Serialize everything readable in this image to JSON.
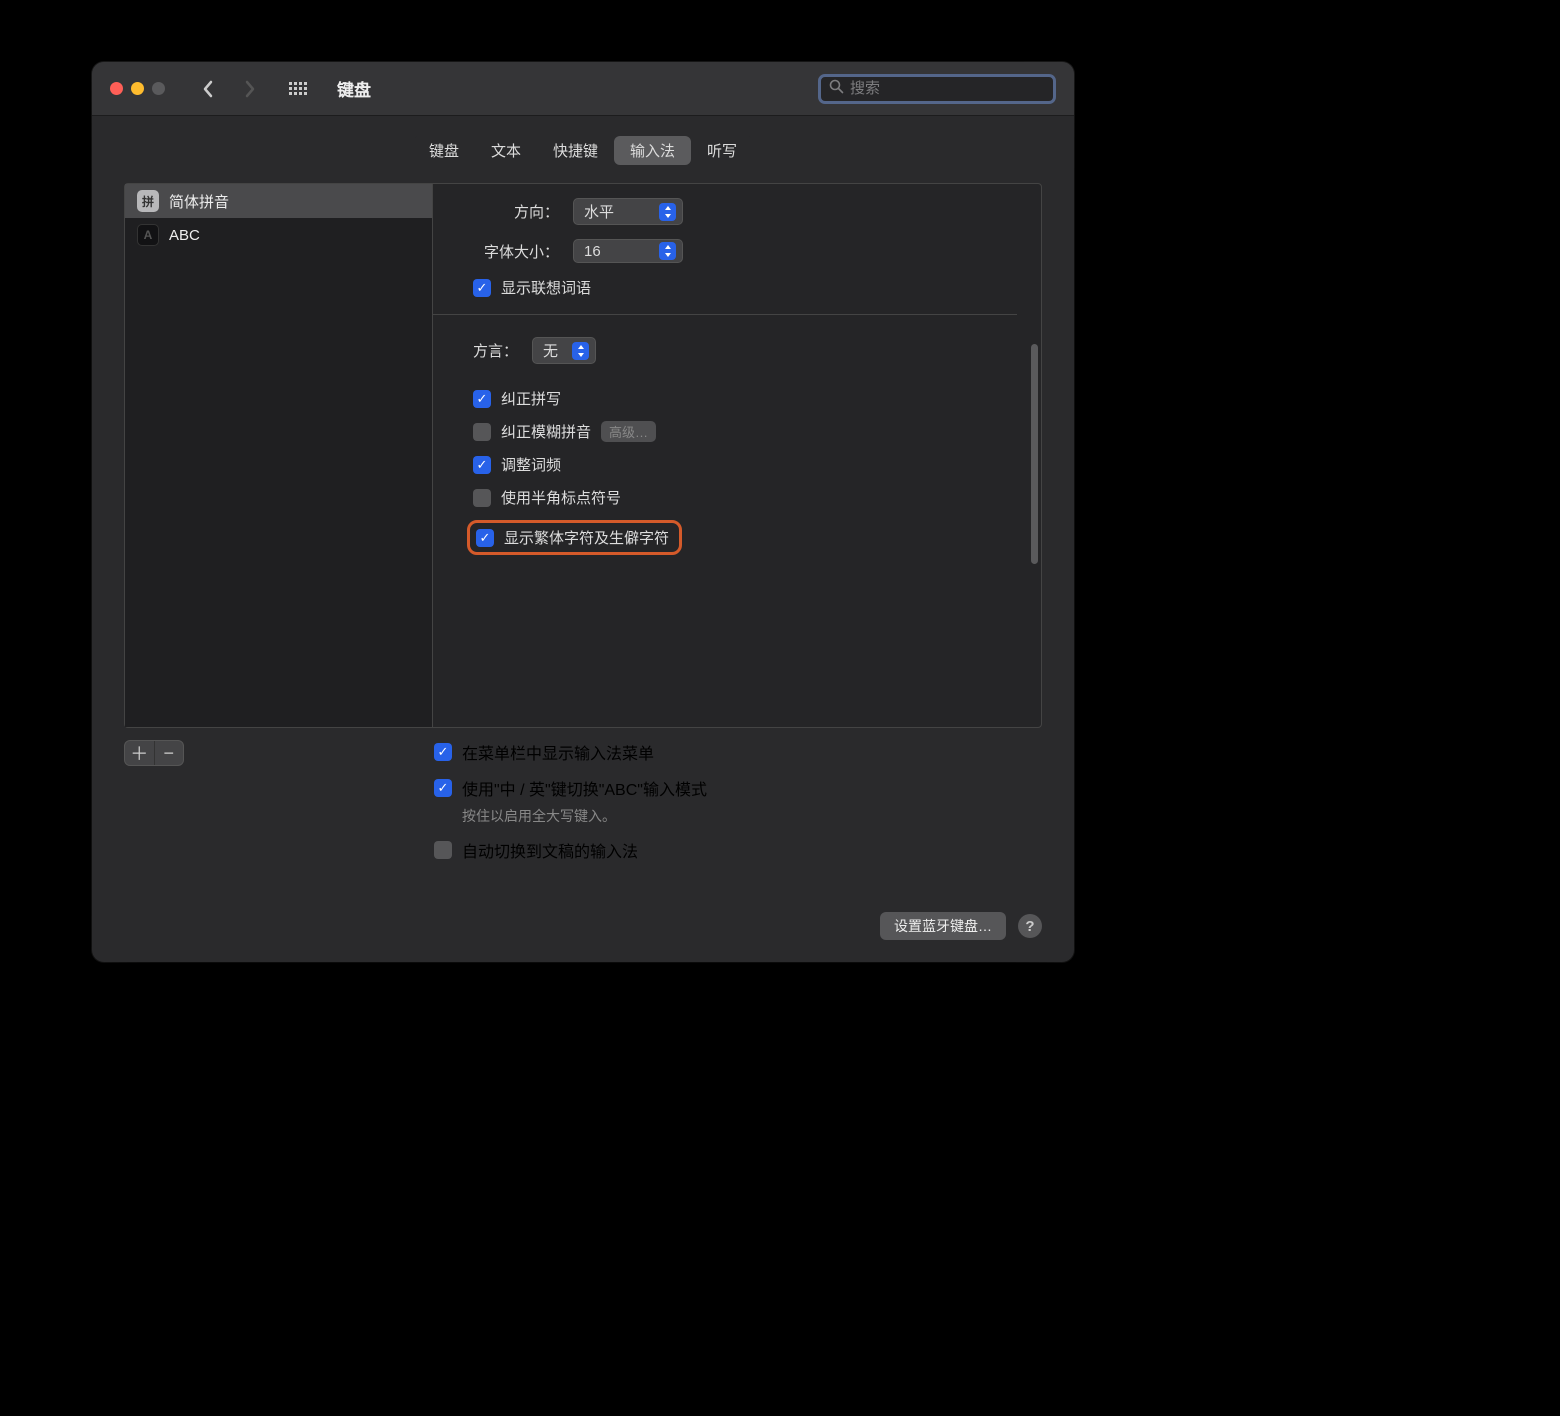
{
  "header": {
    "title": "键盘",
    "search_placeholder": "搜索"
  },
  "tabs": [
    "键盘",
    "文本",
    "快捷键",
    "输入法",
    "听写"
  ],
  "active_tab": 3,
  "sidebar": {
    "items": [
      {
        "badge": "拼",
        "label": "简体拼音",
        "selected": true
      },
      {
        "badge": "A",
        "label": "ABC",
        "selected": false
      }
    ]
  },
  "settings": {
    "direction_label": "方向：",
    "direction_value": "水平",
    "fontsize_label": "字体大小：",
    "fontsize_value": "16",
    "show_suggestions": "显示联想词语",
    "dialect_label": "方言：",
    "dialect_value": "无",
    "correct_spelling": "纠正拼写",
    "correct_fuzzy": "纠正模糊拼音",
    "advanced": "高级…",
    "adjust_freq": "调整词频",
    "halfwidth_punct": "使用半角标点符号",
    "show_trad": "显示繁体字符及生僻字符"
  },
  "global": {
    "menubar": "在菜单栏中显示输入法菜单",
    "switch_abc": "使用\"中 / 英\"键切换\"ABC\"输入模式",
    "switch_sub": "按住以启用全大写键入。",
    "auto_switch": "自动切换到文稿的输入法"
  },
  "footer": {
    "bluetooth": "设置蓝牙键盘…"
  }
}
